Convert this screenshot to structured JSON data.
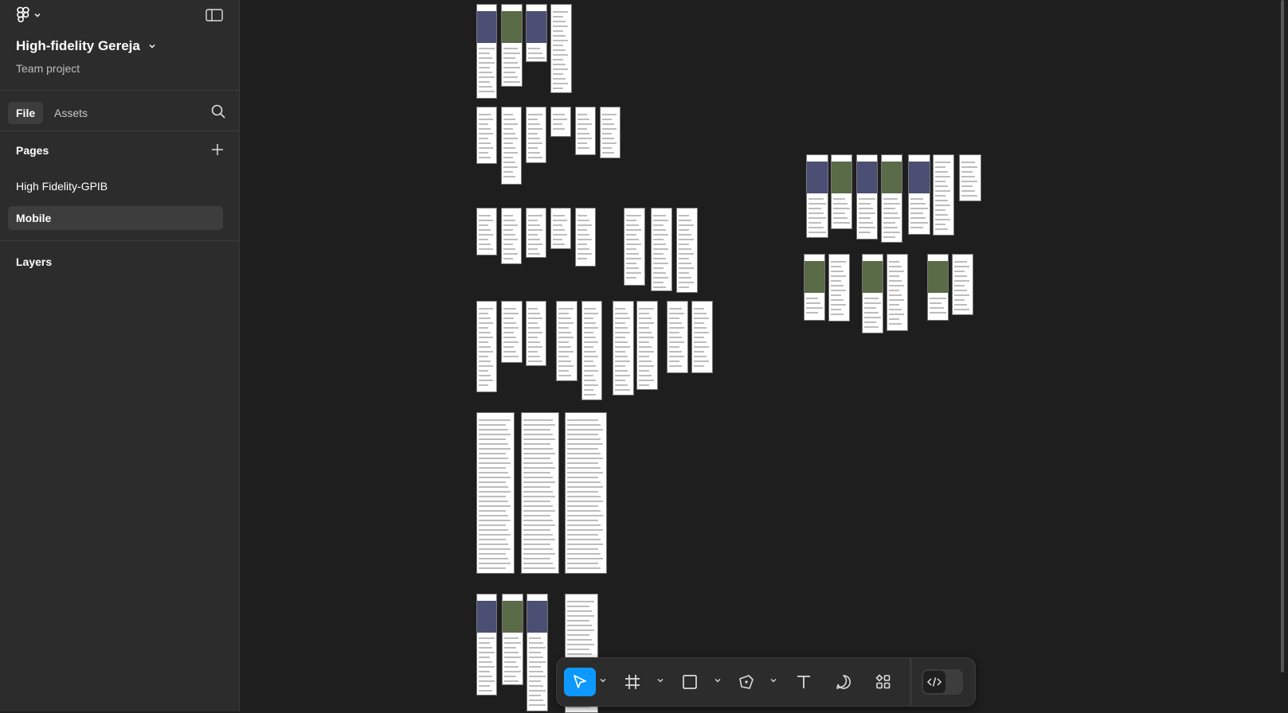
{
  "file": {
    "title": "High-fidelity Gereja",
    "subtitle": "Team project"
  },
  "tabs": {
    "file": "File",
    "assets": "Assets"
  },
  "pages": {
    "header": "Pages",
    "items": [
      "High Fidelity-GPIB",
      "Mobile"
    ],
    "selected": "Mobile"
  },
  "layers": {
    "header": "Layers"
  },
  "icons": {
    "logo": "figma-logo-icon",
    "panel": "sidebar-toggle-icon",
    "search": "search-icon",
    "add": "plus-icon",
    "tools": [
      "move-tool-icon",
      "frame-tool-icon",
      "rectangle-tool-icon",
      "pen-tool-icon",
      "text-tool-icon",
      "comment-tool-icon",
      "actions-icon",
      "dev-mode-icon"
    ]
  },
  "colors": {
    "accent": "#0d99ff",
    "panel": "#2c2c2c",
    "canvas": "#1e1e1e",
    "frame_green": "#5b9a47"
  }
}
